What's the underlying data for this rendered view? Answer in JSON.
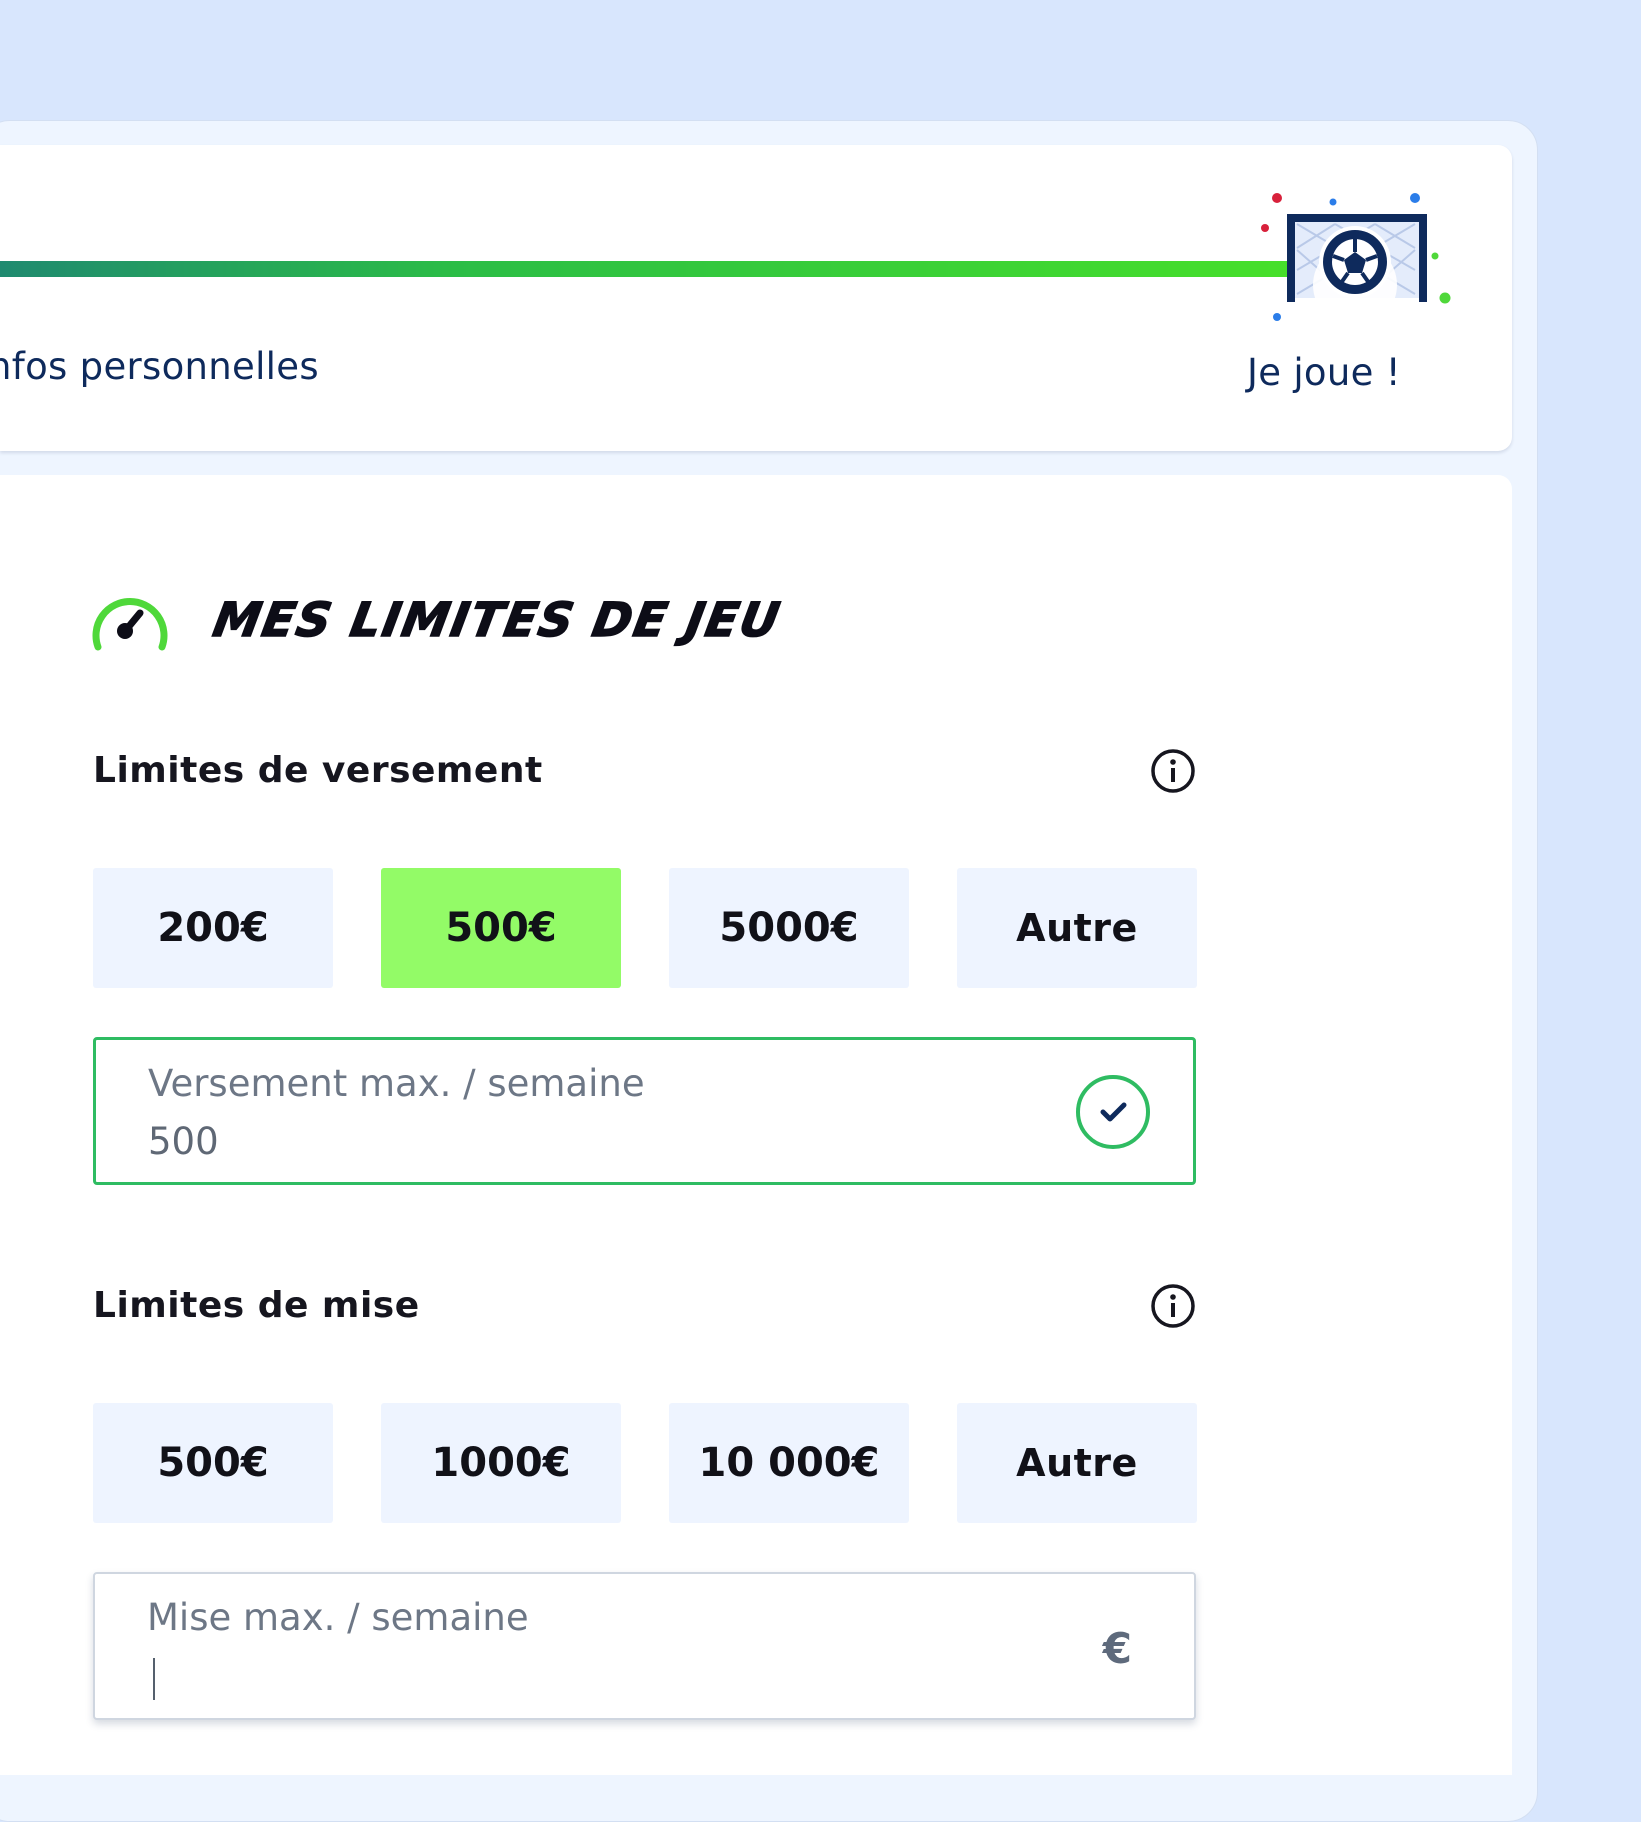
{
  "progress": {
    "previous_step_label": "nfos personnelles",
    "final_step_label": "Je joue !",
    "final_step_icon": "soccer-goal-icon"
  },
  "limits": {
    "title": "MES LIMITES DE JEU",
    "title_icon": "gauge-icon",
    "deposit": {
      "heading": "Limites de versement",
      "info_icon": "info-icon",
      "options": [
        "200€",
        "500€",
        "5000€",
        "Autre"
      ],
      "selected_option": "500€",
      "field_label": "Versement max. / semaine",
      "field_value": "500",
      "field_status_icon": "check-circle-icon"
    },
    "stake": {
      "heading": "Limites de mise",
      "info_icon": "info-icon",
      "options": [
        "500€",
        "1000€",
        "10 000€",
        "Autre"
      ],
      "field_label": "Mise max. / semaine",
      "field_value": "",
      "field_suffix": "€"
    }
  },
  "colors": {
    "page_bg": "#d8e6fd",
    "accent_green": "#93fb67",
    "valid_border": "#2fbc62",
    "navy": "#0e2a5c",
    "chip_bg": "#eef4ff"
  }
}
